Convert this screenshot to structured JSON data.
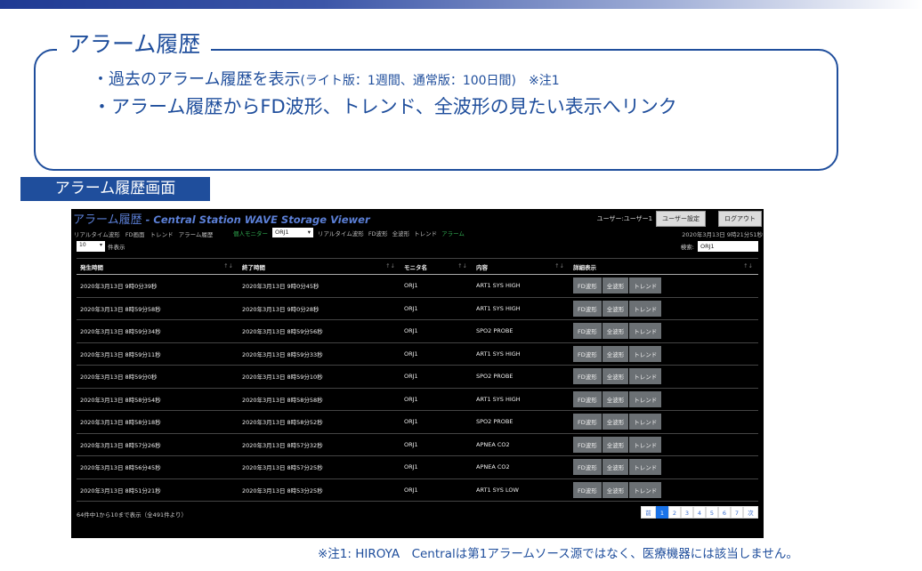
{
  "slide": {
    "title": "アラーム履歴",
    "bullet1_main": "・過去のアラーム履歴を表示",
    "bullet1_detail": "(ライト版：1週間、通常版：100日間)　※注1",
    "bullet2": "・アラーム履歴からFD波形、トレンド、全波形の見たい表示へリンク",
    "section_label": "アラーム履歴画面",
    "footnote": "※注1: HIROYA　Centralは第1アラームソース源ではなく、医療機器には該当しません。"
  },
  "app": {
    "title_main": "アラーム履歴",
    "title_sub": " - Central Station WAVE Storage Viewer",
    "user_label": "ユーザー:ユーザー1",
    "user_settings_button": "ユーザー設定",
    "logout_button": "ログアウト",
    "nav_primary": [
      "リアルタイム波形",
      "FD画面",
      "トレンド",
      "アラーム履歴"
    ],
    "nav_select_label": "個人モニター",
    "nav_select_value": "ORJ1",
    "nav_secondary": [
      "リアルタイム波形",
      "FD波形",
      "全波形",
      "トレンド"
    ],
    "nav_active": "アラーム",
    "datetime": "2020年3月13日 9時21分51秒",
    "length_value": "10",
    "length_suffix": "件表示",
    "search_label": "検索:",
    "search_value": "ORJ1",
    "columns": [
      "発生時間",
      "終了時間",
      "モニタ名",
      "内容",
      "詳細表示"
    ],
    "action_labels": [
      "FD波形",
      "全波形",
      "トレンド"
    ],
    "rows": [
      {
        "start": "2020年3月13日 9時0分39秒",
        "end": "2020年3月13日 9時0分45秒",
        "monitor": "ORJ1",
        "content": "ART1 SYS HIGH"
      },
      {
        "start": "2020年3月13日 8時59分58秒",
        "end": "2020年3月13日 9時0分28秒",
        "monitor": "ORJ1",
        "content": "ART1 SYS HIGH"
      },
      {
        "start": "2020年3月13日 8時59分34秒",
        "end": "2020年3月13日 8時59分56秒",
        "monitor": "ORJ1",
        "content": "SPO2 PROBE"
      },
      {
        "start": "2020年3月13日 8時59分11秒",
        "end": "2020年3月13日 8時59分33秒",
        "monitor": "ORJ1",
        "content": "ART1 SYS HIGH"
      },
      {
        "start": "2020年3月13日 8時59分0秒",
        "end": "2020年3月13日 8時59分10秒",
        "monitor": "ORJ1",
        "content": "SPO2 PROBE"
      },
      {
        "start": "2020年3月13日 8時58分54秒",
        "end": "2020年3月13日 8時58分58秒",
        "monitor": "ORJ1",
        "content": "ART1 SYS HIGH"
      },
      {
        "start": "2020年3月13日 8時58分18秒",
        "end": "2020年3月13日 8時58分52秒",
        "monitor": "ORJ1",
        "content": "SPO2 PROBE"
      },
      {
        "start": "2020年3月13日 8時57分26秒",
        "end": "2020年3月13日 8時57分32秒",
        "monitor": "ORJ1",
        "content": "APNEA CO2"
      },
      {
        "start": "2020年3月13日 8時56分45秒",
        "end": "2020年3月13日 8時57分25秒",
        "monitor": "ORJ1",
        "content": "APNEA CO2"
      },
      {
        "start": "2020年3月13日 8時51分21秒",
        "end": "2020年3月13日 8時53分25秒",
        "monitor": "ORJ1",
        "content": "ART1 SYS LOW"
      }
    ],
    "info": "64件中1から10まで表示（全491件より）",
    "pager": {
      "prev": "前",
      "pages": [
        "1",
        "2",
        "3",
        "4",
        "5",
        "6",
        "7"
      ],
      "next": "次",
      "active": "1"
    }
  }
}
